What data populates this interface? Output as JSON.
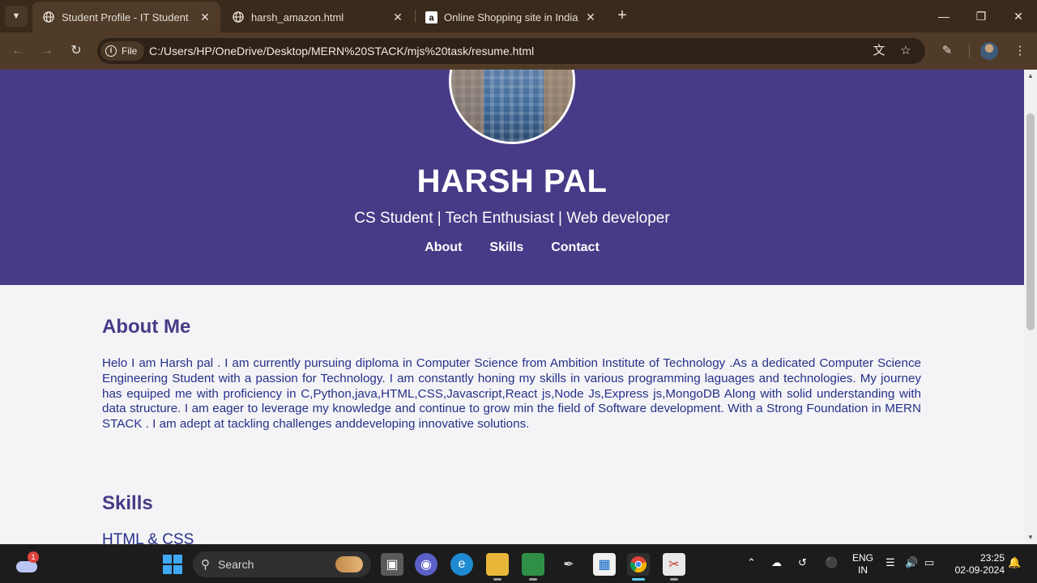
{
  "browser": {
    "tabs": [
      {
        "title": "Student Profile - IT Student",
        "active": true
      },
      {
        "title": "harsh_amazon.html",
        "active": false
      },
      {
        "title": "Online Shopping site in India: S",
        "active": false
      }
    ],
    "url_scheme_chip": "File",
    "url": "C:/Users/HP/OneDrive/Desktop/MERN%20STACK/mjs%20task/resume.html"
  },
  "page": {
    "name": "HARSH PAL",
    "tagline": "CS Student | Tech Enthusiast | Web developer",
    "nav": [
      "About",
      "Skills",
      "Contact"
    ],
    "about": {
      "heading": "About Me",
      "text": "Helo I am Harsh pal . I am currently pursuing diploma in Computer Science from Ambition Institute of Technology .As a dedicated Computer Science Engineering Student with a passion for Technology. I am constantly honing my skills in various programming laguages and technologies. My journey has equiped me with proficiency in C,Python,java,HTML,CSS,Javascript,React js,Node Js,Express js,MongoDB Along with solid understanding with data structure. I am eager to leverage my knowledge and continue to grow min the field of Software development. With a Strong Foundation in MERN STACK . I am adept at tackling challenges anddeveloping innovative solutions."
    },
    "skills": {
      "heading": "Skills",
      "first_item": "HTML & CSS"
    }
  },
  "taskbar": {
    "weather_badge": "1",
    "search_placeholder": "Search",
    "language": {
      "line1": "ENG",
      "line2": "IN"
    },
    "time": "23:25",
    "date": "02-09-2024"
  },
  "colors": {
    "hero_bg": "#483a87",
    "heading": "#483a87",
    "body_text": "#26308a",
    "page_bg": "#f4f4f6"
  }
}
